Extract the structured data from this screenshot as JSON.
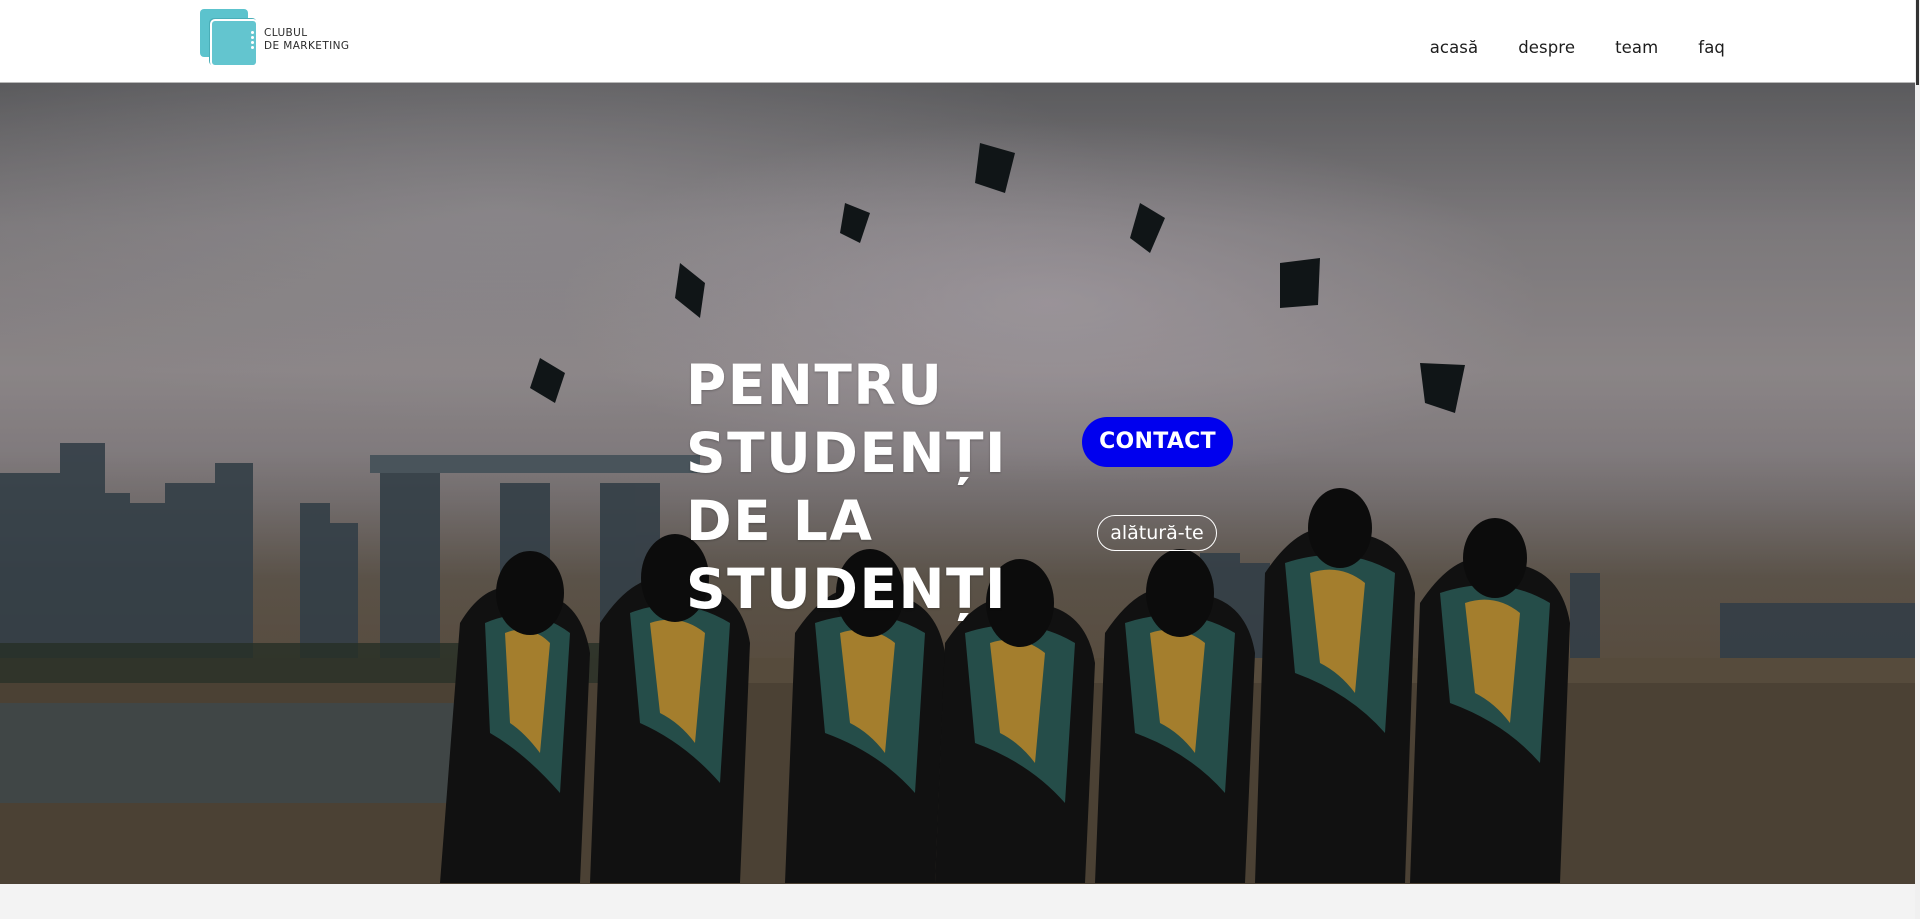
{
  "logo": {
    "line1": "CLUBUL",
    "line2": "DE MARKETING"
  },
  "nav": {
    "items": [
      {
        "label": "acasă"
      },
      {
        "label": "despre"
      },
      {
        "label": "team"
      },
      {
        "label": "faq"
      }
    ]
  },
  "hero": {
    "headline_lines": [
      "PENTRU",
      "STUDENȚI",
      "DE LA",
      "STUDENȚI"
    ],
    "contact_label": "CONTACT",
    "join_label": "alătură-te",
    "background_image": "photo of graduates in black gowns throwing caps in the air against a city skyline"
  },
  "colors": {
    "brand_teal": "#5cc3cd",
    "contact_button": "#0000ee",
    "header_bg": "#ffffff",
    "page_bg": "#f3f3f3"
  }
}
